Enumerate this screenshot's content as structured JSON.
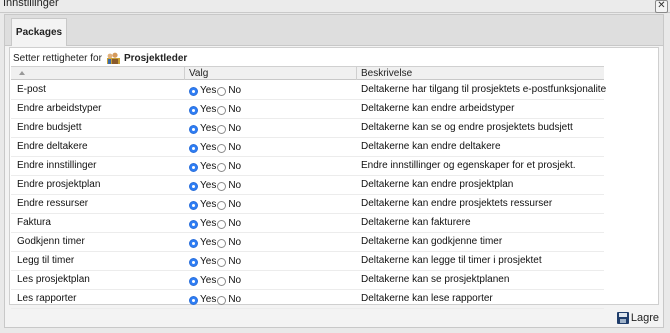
{
  "window": {
    "title": "Innstillinger",
    "close_glyph": "✕"
  },
  "tabs": [
    {
      "label": "Packages",
      "active": true
    }
  ],
  "setter": {
    "prefix": "Setter rettigheter for",
    "role": "Prosjektleder",
    "icon": "group-users-icon"
  },
  "columns": {
    "name": "",
    "valg": "Valg",
    "beskrivelse": "Beskrivelse"
  },
  "options": {
    "yes": "Yes",
    "no": "No"
  },
  "rows": [
    {
      "name": "E-post",
      "selected": "yes",
      "desc": "Deltakerne har tilgang til prosjektets e-postfunksjonalitet"
    },
    {
      "name": "Endre arbeidstyper",
      "selected": "yes",
      "desc": "Deltakerne kan endre arbeidstyper"
    },
    {
      "name": "Endre budsjett",
      "selected": "yes",
      "desc": "Deltakerne kan se og endre prosjektets budsjett"
    },
    {
      "name": "Endre deltakere",
      "selected": "yes",
      "desc": "Deltakerne kan endre deltakere"
    },
    {
      "name": "Endre innstillinger",
      "selected": "yes",
      "desc": "Endre innstillinger og egenskaper for et prosjekt."
    },
    {
      "name": "Endre prosjektplan",
      "selected": "yes",
      "desc": "Deltakerne kan endre prosjektplan"
    },
    {
      "name": "Endre ressurser",
      "selected": "yes",
      "desc": "Deltakerne kan endre prosjektets ressurser"
    },
    {
      "name": "Faktura",
      "selected": "yes",
      "desc": "Deltakerne kan fakturere"
    },
    {
      "name": "Godkjenn timer",
      "selected": "yes",
      "desc": "Deltakerne kan godkjenne timer"
    },
    {
      "name": "Legg til timer",
      "selected": "yes",
      "desc": "Deltakerne kan legge til timer i prosjektet"
    },
    {
      "name": "Les prosjektplan",
      "selected": "yes",
      "desc": "Deltakerne kan se prosjektplanen"
    },
    {
      "name": "Les rapporter",
      "selected": "yes",
      "desc": "Deltakerne kan lese rapporter"
    }
  ],
  "footer": {
    "save_label": "Lagre",
    "save_icon": "floppy-disk-icon"
  }
}
